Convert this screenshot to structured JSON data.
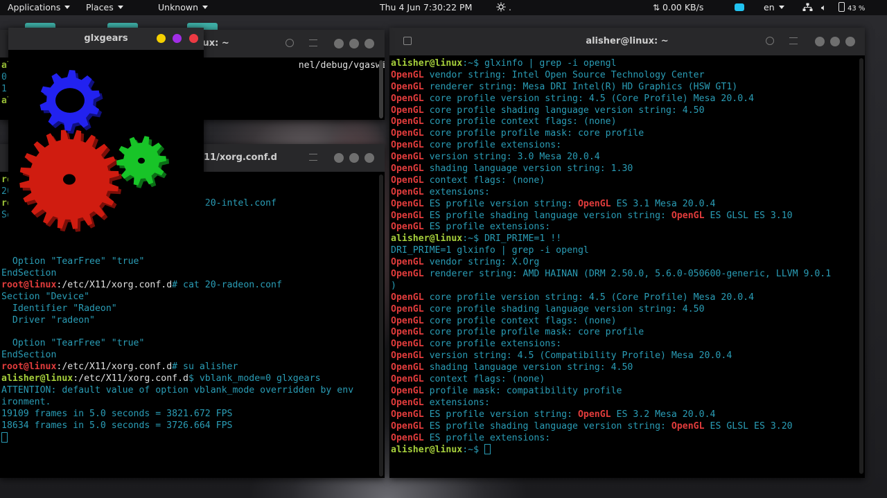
{
  "topbar": {
    "applications": "Applications",
    "places": "Places",
    "unknown": "Unknown",
    "clock": "Thu 4 Jun  7:30:22 PM",
    "weather_dot": ".",
    "network_speed": "0.00 KB/s",
    "language": "en",
    "battery": "43 %"
  },
  "glxgears": {
    "title": "glxgears"
  },
  "term_top": {
    "title_partial": "lux: ~",
    "lines": [
      [
        {
          "t": "al",
          "c": "g"
        },
        {
          "t": "                                                    nel/debug/vgaswitcheroo/switch",
          "c": "w"
        }
      ],
      [
        {
          "t": "0:",
          "c": ""
        }
      ],
      [
        {
          "t": "1:",
          "c": ""
        }
      ],
      [
        {
          "t": "al",
          "c": "g"
        }
      ]
    ]
  },
  "term_mid": {
    "title_partial": "11/xorg.conf.d",
    "lines": [
      [
        {
          "t": "ro",
          "c": "g"
        }
      ],
      [
        {
          "t": "20",
          "c": ""
        }
      ],
      [
        {
          "t": "ro",
          "c": "g"
        },
        {
          "t": "                                 t 20-intel.conf",
          "c": ""
        }
      ],
      [
        {
          "t": "Se",
          "c": ""
        }
      ],
      [
        {
          "t": "",
          "c": ""
        }
      ],
      [
        {
          "t": "",
          "c": ""
        }
      ],
      [
        {
          "t": "",
          "c": ""
        }
      ],
      [
        {
          "t": "  Option \"TearFree\" \"true\"",
          "c": ""
        }
      ],
      [
        {
          "t": "EndSection",
          "c": ""
        }
      ],
      [
        {
          "t": "root@linux",
          "c": "r"
        },
        {
          "t": ":/etc/X11/xorg.conf.d",
          "c": "w"
        },
        {
          "t": "# cat 20-radeon.conf",
          "c": ""
        }
      ],
      [
        {
          "t": "Section \"Device\"",
          "c": ""
        }
      ],
      [
        {
          "t": "  Identifier \"Radeon\"",
          "c": ""
        }
      ],
      [
        {
          "t": "  Driver \"radeon\"",
          "c": ""
        }
      ],
      [
        {
          "t": "",
          "c": ""
        }
      ],
      [
        {
          "t": "  Option \"TearFree\" \"true\"",
          "c": ""
        }
      ],
      [
        {
          "t": "EndSection",
          "c": ""
        }
      ],
      [
        {
          "t": "root@linux",
          "c": "r"
        },
        {
          "t": ":/etc/X11/xorg.conf.d",
          "c": "w"
        },
        {
          "t": "# su alisher",
          "c": ""
        }
      ],
      [
        {
          "t": "alisher@linux",
          "c": "g"
        },
        {
          "t": ":/etc/X11/xorg.conf.d",
          "c": "w"
        },
        {
          "t": "$ vblank_mode=0 glxgears",
          "c": ""
        }
      ],
      [
        {
          "t": "ATTENTION: default value of option vblank_mode overridden by env",
          "c": ""
        }
      ],
      [
        {
          "t": "ironment.",
          "c": ""
        }
      ],
      [
        {
          "t": "19109 frames in 5.0 seconds = 3821.672 FPS",
          "c": ""
        }
      ],
      [
        {
          "t": "18634 frames in 5.0 seconds = 3726.664 FPS",
          "c": ""
        }
      ]
    ]
  },
  "term_right": {
    "title": "alisher@linux: ~",
    "lines": [
      [
        {
          "t": "alisher@linux",
          "c": "g"
        },
        {
          "t": ":~$ glxinfo | grep -i opengl",
          "c": ""
        }
      ],
      [
        {
          "t": "OpenGL",
          "c": "r"
        },
        {
          "t": " vendor string: Intel Open Source Technology Center",
          "c": ""
        }
      ],
      [
        {
          "t": "OpenGL",
          "c": "r"
        },
        {
          "t": " renderer string: Mesa DRI Intel(R) HD Graphics (HSW GT1)",
          "c": ""
        }
      ],
      [
        {
          "t": "OpenGL",
          "c": "r"
        },
        {
          "t": " core profile version string: 4.5 (Core Profile) Mesa 20.0.4",
          "c": ""
        }
      ],
      [
        {
          "t": "OpenGL",
          "c": "r"
        },
        {
          "t": " core profile shading language version string: 4.50",
          "c": ""
        }
      ],
      [
        {
          "t": "OpenGL",
          "c": "r"
        },
        {
          "t": " core profile context flags: (none)",
          "c": ""
        }
      ],
      [
        {
          "t": "OpenGL",
          "c": "r"
        },
        {
          "t": " core profile profile mask: core profile",
          "c": ""
        }
      ],
      [
        {
          "t": "OpenGL",
          "c": "r"
        },
        {
          "t": " core profile extensions:",
          "c": ""
        }
      ],
      [
        {
          "t": "OpenGL",
          "c": "r"
        },
        {
          "t": " version string: 3.0 Mesa 20.0.4",
          "c": ""
        }
      ],
      [
        {
          "t": "OpenGL",
          "c": "r"
        },
        {
          "t": " shading language version string: 1.30",
          "c": ""
        }
      ],
      [
        {
          "t": "OpenGL",
          "c": "r"
        },
        {
          "t": " context flags: (none)",
          "c": ""
        }
      ],
      [
        {
          "t": "OpenGL",
          "c": "r"
        },
        {
          "t": " extensions:",
          "c": ""
        }
      ],
      [
        {
          "t": "OpenGL",
          "c": "r"
        },
        {
          "t": " ES profile version string: ",
          "c": ""
        },
        {
          "t": "OpenGL",
          "c": "r"
        },
        {
          "t": " ES 3.1 Mesa 20.0.4",
          "c": ""
        }
      ],
      [
        {
          "t": "OpenGL",
          "c": "r"
        },
        {
          "t": " ES profile shading language version string: ",
          "c": ""
        },
        {
          "t": "OpenGL",
          "c": "r"
        },
        {
          "t": " ES GLSL ES 3.10",
          "c": ""
        }
      ],
      [
        {
          "t": "OpenGL",
          "c": "r"
        },
        {
          "t": " ES profile extensions:",
          "c": ""
        }
      ],
      [
        {
          "t": "alisher@linux",
          "c": "g"
        },
        {
          "t": ":~$ DRI_PRIME=1 !!",
          "c": ""
        }
      ],
      [
        {
          "t": "DRI_PRIME=1 glxinfo | grep -i opengl",
          "c": ""
        }
      ],
      [
        {
          "t": "OpenGL",
          "c": "r"
        },
        {
          "t": " vendor string: X.Org",
          "c": ""
        }
      ],
      [
        {
          "t": "OpenGL",
          "c": "r"
        },
        {
          "t": " renderer string: AMD HAINAN (DRM 2.50.0, 5.6.0-050600-generic, LLVM 9.0.1",
          "c": ""
        }
      ],
      [
        {
          "t": ")",
          "c": ""
        }
      ],
      [
        {
          "t": "OpenGL",
          "c": "r"
        },
        {
          "t": " core profile version string: 4.5 (Core Profile) Mesa 20.0.4",
          "c": ""
        }
      ],
      [
        {
          "t": "OpenGL",
          "c": "r"
        },
        {
          "t": " core profile shading language version string: 4.50",
          "c": ""
        }
      ],
      [
        {
          "t": "OpenGL",
          "c": "r"
        },
        {
          "t": " core profile context flags: (none)",
          "c": ""
        }
      ],
      [
        {
          "t": "OpenGL",
          "c": "r"
        },
        {
          "t": " core profile profile mask: core profile",
          "c": ""
        }
      ],
      [
        {
          "t": "OpenGL",
          "c": "r"
        },
        {
          "t": " core profile extensions:",
          "c": ""
        }
      ],
      [
        {
          "t": "OpenGL",
          "c": "r"
        },
        {
          "t": " version string: 4.5 (Compatibility Profile) Mesa 20.0.4",
          "c": ""
        }
      ],
      [
        {
          "t": "OpenGL",
          "c": "r"
        },
        {
          "t": " shading language version string: 4.50",
          "c": ""
        }
      ],
      [
        {
          "t": "OpenGL",
          "c": "r"
        },
        {
          "t": " context flags: (none)",
          "c": ""
        }
      ],
      [
        {
          "t": "OpenGL",
          "c": "r"
        },
        {
          "t": " profile mask: compatibility profile",
          "c": ""
        }
      ],
      [
        {
          "t": "OpenGL",
          "c": "r"
        },
        {
          "t": " extensions:",
          "c": ""
        }
      ],
      [
        {
          "t": "OpenGL",
          "c": "r"
        },
        {
          "t": " ES profile version string: ",
          "c": ""
        },
        {
          "t": "OpenGL",
          "c": "r"
        },
        {
          "t": " ES 3.2 Mesa 20.0.4",
          "c": ""
        }
      ],
      [
        {
          "t": "OpenGL",
          "c": "r"
        },
        {
          "t": " ES profile shading language version string: ",
          "c": ""
        },
        {
          "t": "OpenGL",
          "c": "r"
        },
        {
          "t": " ES GLSL ES 3.20",
          "c": ""
        }
      ],
      [
        {
          "t": "OpenGL",
          "c": "r"
        },
        {
          "t": " ES profile extensions:",
          "c": ""
        }
      ],
      [
        {
          "t": "alisher@linux",
          "c": "g"
        },
        {
          "t": ":~$ ",
          "c": ""
        }
      ]
    ]
  },
  "colors": {
    "prompt_green": "#a7d13c",
    "opengl_red": "#e23c3c",
    "text_cyan": "#2a9db6",
    "gear_red": "#d01c10",
    "gear_green": "#18c428",
    "gear_blue": "#2222f0"
  },
  "icons": [
    "applications-caret",
    "places-caret",
    "unknown-caret",
    "weather-icon",
    "network-icon",
    "keyboard-icon",
    "network-tray-icon",
    "volume-icon",
    "battery-icon",
    "search-icon",
    "menu-icon",
    "new-tab-icon",
    "minimize-icon",
    "maximize-icon",
    "close-icon"
  ]
}
